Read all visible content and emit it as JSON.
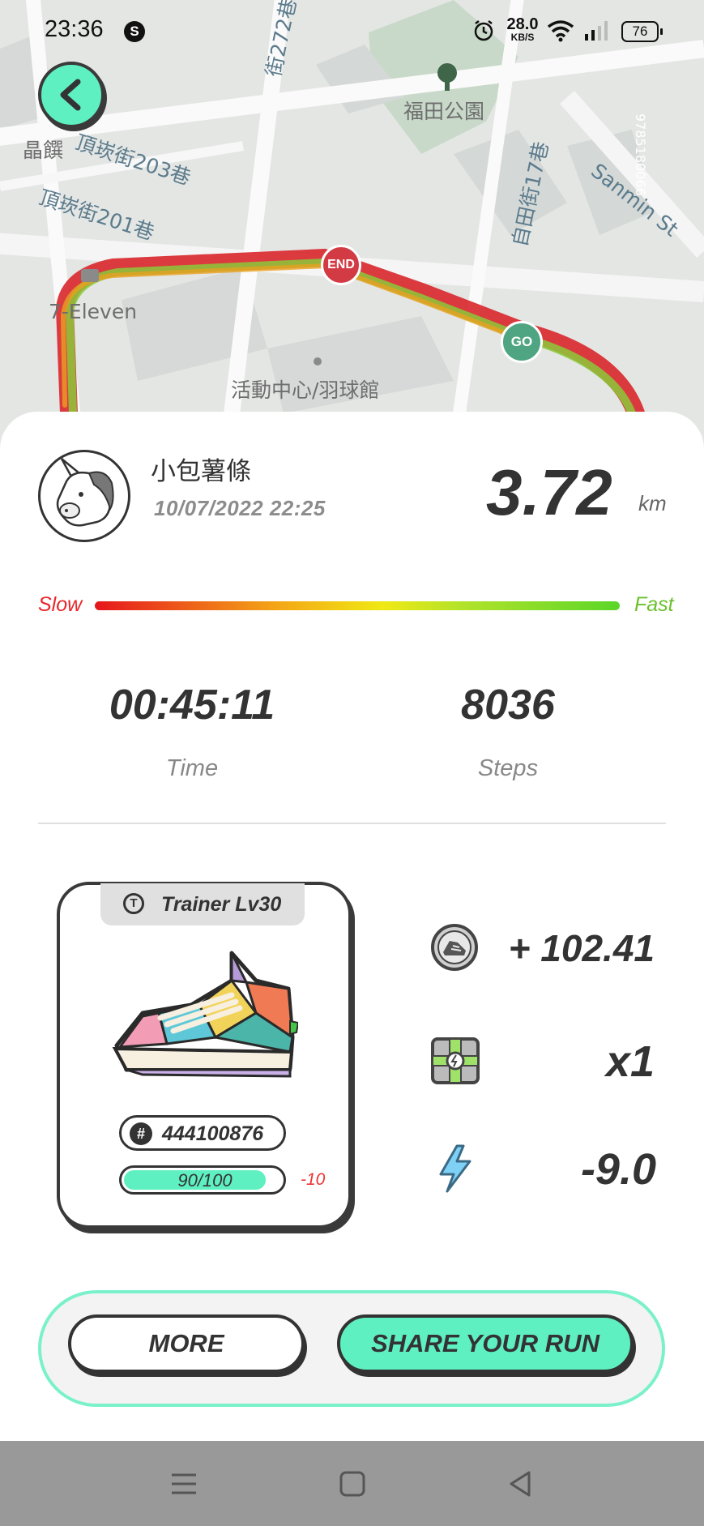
{
  "status_bar": {
    "time": "23:36",
    "app_icon": "S",
    "net_speed_value": "28.0",
    "net_speed_unit": "KB/S",
    "battery": "76"
  },
  "map": {
    "labels": {
      "park": "福田公園",
      "jingzhuan": "晶饌",
      "lane_203": "頂崁街203巷",
      "lane_201": "頂崁街201巷",
      "lane_272": "街272巷",
      "ziyou_lane_17": "自田街17巷",
      "seven_eleven": "7-Eleven",
      "activity_center": "活動中心/羽球館",
      "sanmin": "Sanmin St",
      "watermark": "9785180066"
    },
    "markers": {
      "end": "END",
      "go": "GO"
    }
  },
  "summary": {
    "user_name": "小包薯條",
    "date": "10/07/2022 22:25",
    "distance": "3.72",
    "distance_unit": "km",
    "speed_slow": "Slow",
    "speed_fast": "Fast"
  },
  "stats": {
    "time_value": "00:45:11",
    "time_label": "Time",
    "steps_value": "8036",
    "steps_label": "Steps"
  },
  "sneaker": {
    "type_level": "Trainer Lv30",
    "type_icon": "T",
    "id_symbol": "#",
    "id": "444100876",
    "durability_text": "90/100",
    "durability_fraction": 0.9,
    "durability_delta": "-10"
  },
  "rewards": {
    "gst": "+ 102.41",
    "mystery_box": "x1",
    "energy": "-9.0"
  },
  "buttons": {
    "more": "MORE",
    "share": "SHARE YOUR RUN"
  },
  "colors": {
    "accent": "#5ff0c2",
    "end_marker": "#d23a44",
    "go_marker": "#4fa582",
    "slow": "#e8262b",
    "fast": "#6ac12b"
  }
}
